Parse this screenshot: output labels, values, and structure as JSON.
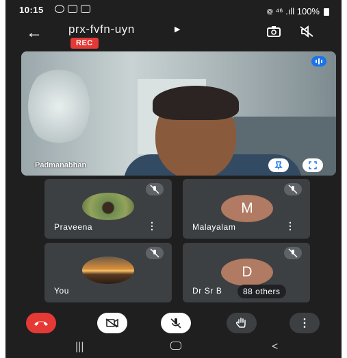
{
  "status_bar": {
    "time": "10:15",
    "right_text": "᪤ ⁴⁶ .ıll 100%"
  },
  "meeting": {
    "code": "prx-fvfn-uyn",
    "rec_label": "REC"
  },
  "main_video": {
    "participant_name": "Padmanabhan"
  },
  "participants": [
    {
      "name": "Praveena",
      "avatar": "photo"
    },
    {
      "name": "Malayalam",
      "avatar_letter": "M"
    },
    {
      "name": "You",
      "avatar": "photo"
    },
    {
      "name": "Dr Sr B",
      "avatar_letter": "D"
    }
  ],
  "others_label": "88 others",
  "colors": {
    "background": "#1f1f1f",
    "tile": "#3c4043",
    "end_call": "#e53935",
    "accent": "#1a73e8",
    "rec": "#e53935"
  },
  "icons": {
    "back": "arrow-left-icon",
    "camera_switch": "camera-switch-icon",
    "speaker_off": "speaker-off-icon",
    "speaking": "speaking-indicator-icon",
    "pin": "pin-icon",
    "fullscreen": "fullscreen-icon",
    "mic_off": "mic-off-icon",
    "end_call": "phone-hangup-icon",
    "camera_off": "camera-off-icon",
    "raise_hand": "hand-icon",
    "more": "more-vert-icon"
  }
}
